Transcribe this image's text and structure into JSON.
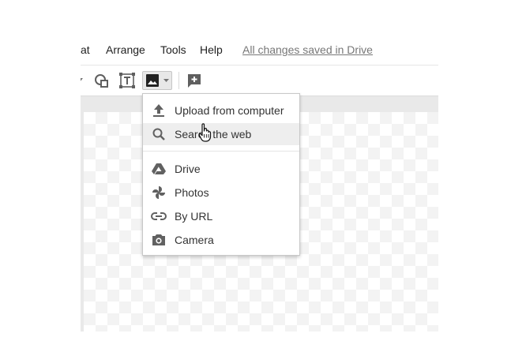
{
  "menubar": {
    "items": [
      {
        "label": "at"
      },
      {
        "label": "Arrange"
      },
      {
        "label": "Tools"
      },
      {
        "label": "Help"
      }
    ],
    "save_status": "All changes saved in Drive"
  },
  "toolbar": {
    "buttons": [
      {
        "icon": "chevron-down-icon"
      },
      {
        "icon": "shape-icon"
      },
      {
        "icon": "text-box-icon"
      },
      {
        "icon": "image-icon",
        "active": true
      },
      {
        "icon": "add-comment-icon"
      }
    ]
  },
  "image_menu": {
    "items": [
      {
        "label": "Upload from computer",
        "icon": "upload-icon"
      },
      {
        "label": "Search the web",
        "icon": "search-icon",
        "hovered": true
      },
      {
        "label": "Drive",
        "icon": "drive-icon"
      },
      {
        "label": "Photos",
        "icon": "photos-icon"
      },
      {
        "label": "By URL",
        "icon": "link-icon"
      },
      {
        "label": "Camera",
        "icon": "camera-icon"
      }
    ]
  },
  "colors": {
    "text": "#333333",
    "save_status": "#777777",
    "hover": "#eeeeee",
    "icon": "#616161"
  }
}
